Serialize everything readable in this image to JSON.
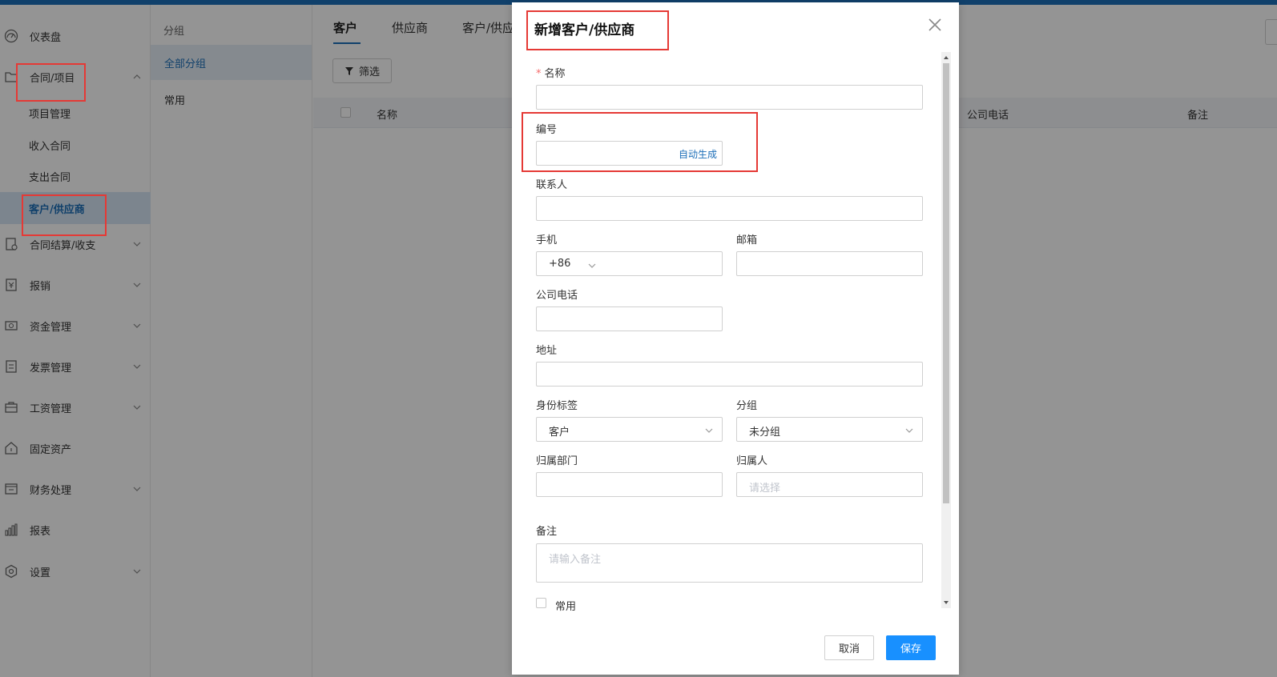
{
  "sidebar": {
    "items": [
      {
        "label": "仪表盘",
        "icon": "dashboard-icon"
      },
      {
        "label": "合同/项目",
        "icon": "folder-icon",
        "expanded": true
      },
      {
        "label": "合同结算/收支",
        "icon": "settlement-icon"
      },
      {
        "label": "报销",
        "icon": "reimburse-icon"
      },
      {
        "label": "资金管理",
        "icon": "funds-icon"
      },
      {
        "label": "发票管理",
        "icon": "invoice-icon"
      },
      {
        "label": "工资管理",
        "icon": "salary-icon"
      },
      {
        "label": "固定资产",
        "icon": "asset-icon"
      },
      {
        "label": "财务处理",
        "icon": "finance-icon"
      },
      {
        "label": "报表",
        "icon": "report-icon"
      },
      {
        "label": "设置",
        "icon": "settings-icon"
      }
    ],
    "sub_items": [
      {
        "label": "项目管理"
      },
      {
        "label": "收入合同"
      },
      {
        "label": "支出合同"
      },
      {
        "label": "客户/供应商",
        "active": true
      }
    ]
  },
  "groups": {
    "title": "分组",
    "items": [
      {
        "label": "全部分组",
        "active": true
      },
      {
        "label": "常用"
      }
    ]
  },
  "main": {
    "tabs": [
      {
        "label": "客户",
        "active": true
      },
      {
        "label": "供应商"
      },
      {
        "label": "客户/供应"
      }
    ],
    "filter_label": "筛选",
    "columns": [
      {
        "label": "名称"
      },
      {
        "label": "公司电话"
      },
      {
        "label": "备注"
      }
    ]
  },
  "modal": {
    "title": "新增客户/供应商",
    "fields": {
      "name": {
        "label": "名称",
        "required": "*"
      },
      "code": {
        "label": "编号",
        "action": "自动生成"
      },
      "contact": {
        "label": "联系人"
      },
      "phone": {
        "label": "手机",
        "prefix": "+86"
      },
      "email": {
        "label": "邮箱"
      },
      "company_phone": {
        "label": "公司电话"
      },
      "address": {
        "label": "地址"
      },
      "identity": {
        "label": "身份标签",
        "value": "客户"
      },
      "group": {
        "label": "分组",
        "value": "未分组"
      },
      "department": {
        "label": "归属部门"
      },
      "owner": {
        "label": "归属人",
        "placeholder": "请选择"
      },
      "remark": {
        "label": "备注",
        "placeholder": "请输入备注"
      },
      "favorite": {
        "label": "常用"
      }
    },
    "cancel_label": "取消",
    "save_label": "保存"
  },
  "colors": {
    "primary": "#1d6fb8",
    "save_button": "#1890ff",
    "highlight": "#e53935",
    "required": "#f56c6c"
  }
}
